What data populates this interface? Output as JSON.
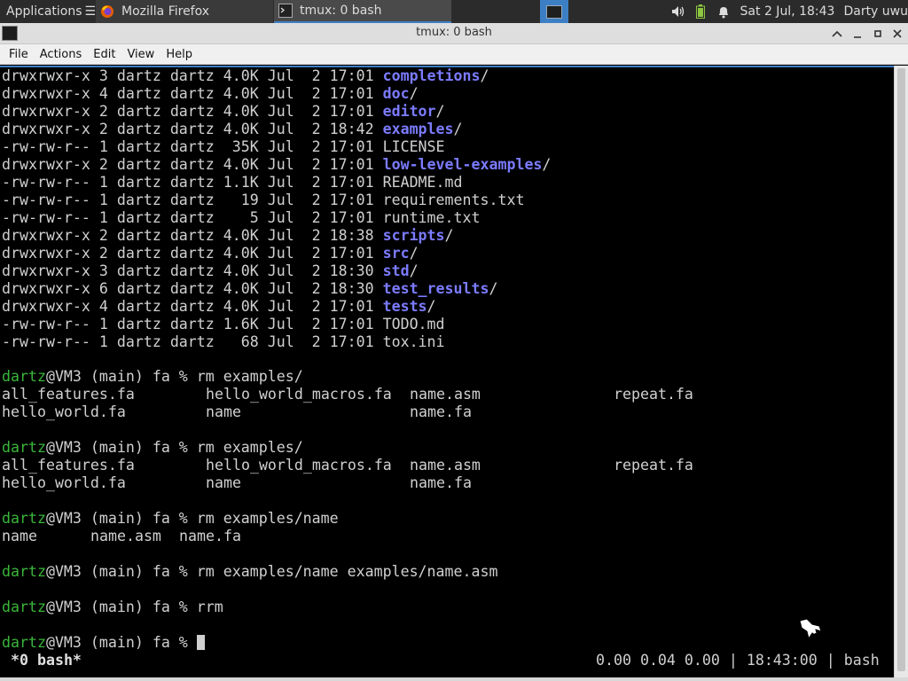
{
  "panel": {
    "apps_label": "Applications",
    "tasks": [
      {
        "label": "Mozilla Firefox",
        "icon": "firefox-icon"
      },
      {
        "label": "tmux: 0 bash",
        "icon": "terminal-icon"
      }
    ],
    "clock": "Sat  2 Jul, 18:43",
    "user": "Darty uwu"
  },
  "window": {
    "title": "tmux: 0 bash",
    "menus": [
      "File",
      "Actions",
      "Edit",
      "View",
      "Help"
    ]
  },
  "terminal": {
    "listing": [
      {
        "meta": "drwxrwxr-x 3 dartz dartz 4.0K Jul  2 17:01 ",
        "name": "completions",
        "dir": true
      },
      {
        "meta": "drwxrwxr-x 4 dartz dartz 4.0K Jul  2 17:01 ",
        "name": "doc",
        "dir": true
      },
      {
        "meta": "drwxrwxr-x 2 dartz dartz 4.0K Jul  2 17:01 ",
        "name": "editor",
        "dir": true
      },
      {
        "meta": "drwxrwxr-x 2 dartz dartz 4.0K Jul  2 18:42 ",
        "name": "examples",
        "dir": true
      },
      {
        "meta": "-rw-rw-r-- 1 dartz dartz  35K Jul  2 17:01 ",
        "name": "LICENSE",
        "dir": false
      },
      {
        "meta": "drwxrwxr-x 2 dartz dartz 4.0K Jul  2 17:01 ",
        "name": "low-level-examples",
        "dir": true
      },
      {
        "meta": "-rw-rw-r-- 1 dartz dartz 1.1K Jul  2 17:01 ",
        "name": "README.md",
        "dir": false
      },
      {
        "meta": "-rw-rw-r-- 1 dartz dartz   19 Jul  2 17:01 ",
        "name": "requirements.txt",
        "dir": false
      },
      {
        "meta": "-rw-rw-r-- 1 dartz dartz    5 Jul  2 17:01 ",
        "name": "runtime.txt",
        "dir": false
      },
      {
        "meta": "drwxrwxr-x 2 dartz dartz 4.0K Jul  2 18:38 ",
        "name": "scripts",
        "dir": true
      },
      {
        "meta": "drwxrwxr-x 2 dartz dartz 4.0K Jul  2 17:01 ",
        "name": "src",
        "dir": true
      },
      {
        "meta": "drwxrwxr-x 3 dartz dartz 4.0K Jul  2 18:30 ",
        "name": "std",
        "dir": true
      },
      {
        "meta": "drwxrwxr-x 6 dartz dartz 4.0K Jul  2 18:30 ",
        "name": "test_results",
        "dir": true
      },
      {
        "meta": "drwxrwxr-x 4 dartz dartz 4.0K Jul  2 17:01 ",
        "name": "tests",
        "dir": true
      },
      {
        "meta": "-rw-rw-r-- 1 dartz dartz 1.6K Jul  2 17:01 ",
        "name": "TODO.md",
        "dir": false
      },
      {
        "meta": "-rw-rw-r-- 1 dartz dartz   68 Jul  2 17:01 ",
        "name": "tox.ini",
        "dir": false
      }
    ],
    "prompt_user": "dartz",
    "prompt_rest": "@VM3 (main) fa % ",
    "commands": [
      "rm examples/",
      "rm examples/",
      "rm examples/name",
      "rm examples/name examples/name.asm",
      "rrm",
      ""
    ],
    "completions_a": {
      "row1": [
        "all_features.fa",
        "hello_world_macros.fa",
        "name.asm",
        "repeat.fa"
      ],
      "row2": [
        "hello_world.fa",
        "name",
        "name.fa"
      ]
    },
    "completions_c": [
      "name",
      "name.asm",
      "name.fa"
    ]
  },
  "tmux_status": {
    "left": "*0 bash*",
    "right": "0.00 0.04 0.00 | 18:43:00 | bash"
  },
  "colors": {
    "directory": "#7b7bff",
    "prompt_user": "#3ab53a",
    "accent": "#3c7fc4"
  }
}
